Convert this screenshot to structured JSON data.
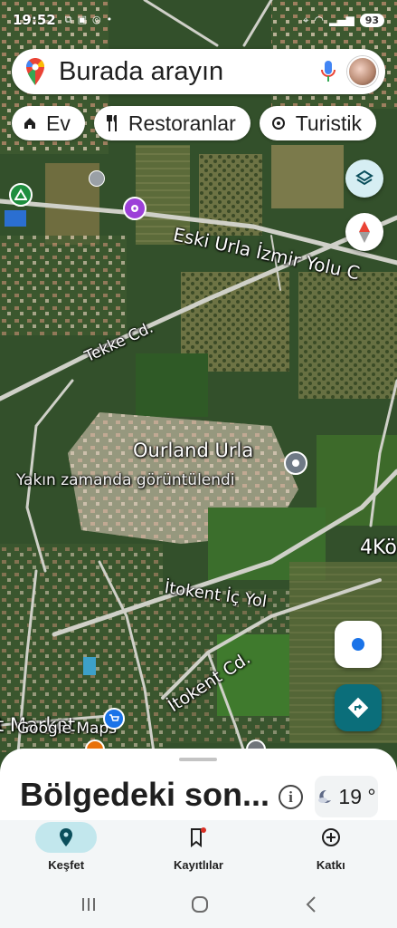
{
  "status_bar": {
    "time": "19:52",
    "battery": "93"
  },
  "search": {
    "placeholder": "Burada arayın"
  },
  "chips": [
    {
      "label": "Ev",
      "icon": "home-icon"
    },
    {
      "label": "Restoranlar",
      "icon": "restaurant-icon"
    },
    {
      "label": "Turistik",
      "icon": "attraction-icon"
    }
  ],
  "map": {
    "roads": {
      "eski_urla": "Eski Urla İzmir Yolu C",
      "tekke": "Tekke Cd.",
      "itokent_ic": "İtokent İç Yol",
      "itokent": "İtokent Cd.",
      "k4": "4Kö"
    },
    "place": {
      "name": "Ourland Urla",
      "subtitle": "Yakın zamanda görüntülendi"
    },
    "partial_market": "t Market",
    "watermark": "Google Maps"
  },
  "sheet": {
    "title": "Bölgedeki son...",
    "temperature": "19 °"
  },
  "nav": [
    {
      "label": "Keşfet",
      "icon": "explore-pin-icon",
      "active": true
    },
    {
      "label": "Kayıtlılar",
      "icon": "saved-bookmark-icon",
      "active": false
    },
    {
      "label": "Katkı",
      "icon": "contribute-plus-icon",
      "active": false
    }
  ],
  "colors": {
    "accent": "#0b6e7a",
    "active_pill": "#c2e7ed",
    "location_dot": "#1a73e8"
  }
}
